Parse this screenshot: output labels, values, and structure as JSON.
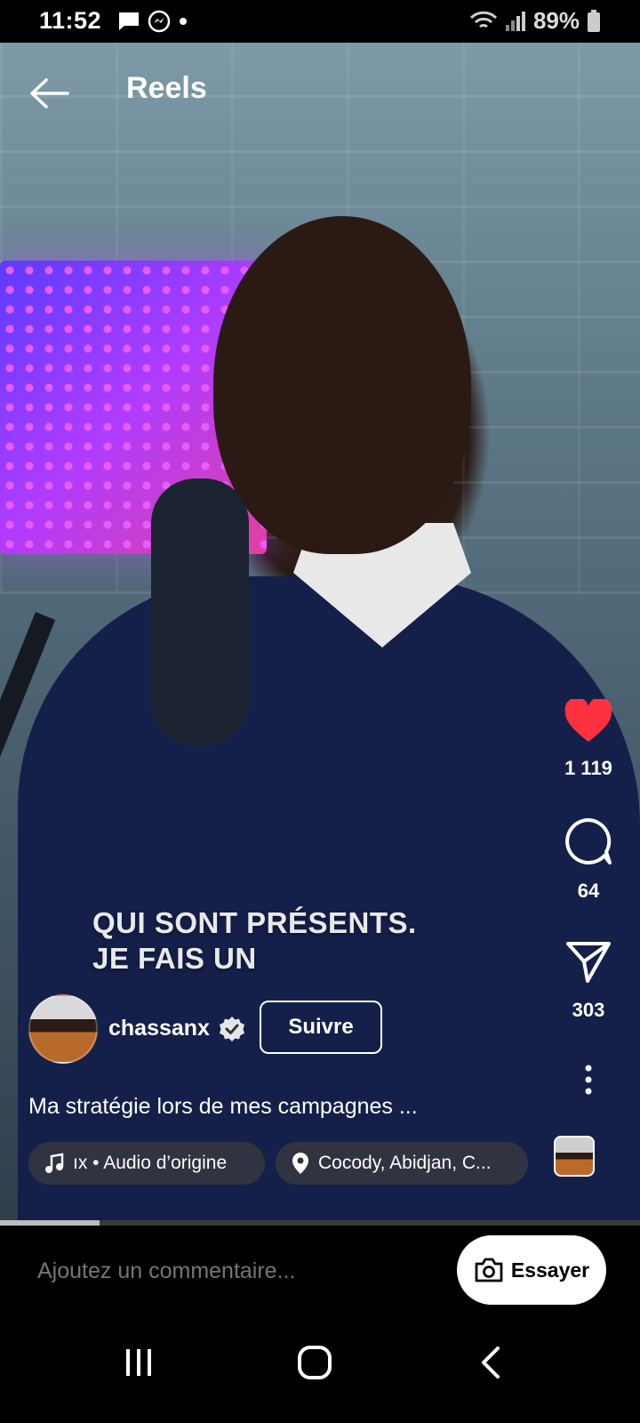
{
  "status_bar": {
    "time": "11:52",
    "battery": "89%",
    "icons": [
      "message-icon",
      "messenger-icon",
      "dot-icon",
      "wifi-icon",
      "signal-icon",
      "battery-icon"
    ]
  },
  "header": {
    "title": "Reels",
    "back_icon": "arrow-left-icon"
  },
  "video": {
    "caption_line1": "QUI SONT PRÉSENTS.",
    "caption_line2": "JE FAIS UN",
    "progress_fraction": 0.155
  },
  "actions": {
    "likes": "1 119",
    "comments": "64",
    "shares": "303",
    "like_color": "#ff3040"
  },
  "author": {
    "username": "chassanx",
    "verified": true,
    "follow_label": "Suivre"
  },
  "post": {
    "description": "Ma stratégie lors de mes campagnes ...",
    "audio_label": "ıx • Audio d’origine",
    "location_label": "Cocody, Abidjan, C..."
  },
  "comment_bar": {
    "placeholder": "Ajoutez un commentaire...",
    "try_label": "Essayer"
  },
  "nav": {
    "icons": [
      "recent-apps-icon",
      "home-icon",
      "back-icon"
    ]
  }
}
